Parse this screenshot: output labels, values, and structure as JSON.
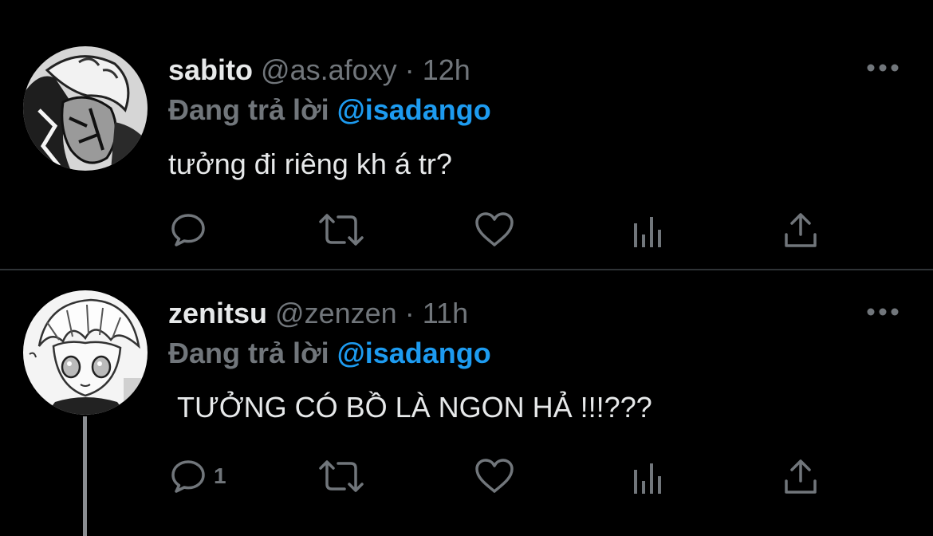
{
  "colors": {
    "background": "#000000",
    "text_primary": "#e7e9ea",
    "text_secondary": "#71767b",
    "mention_blue": "#1d9bf0",
    "divider": "#2f3336"
  },
  "tweets": [
    {
      "display_name": "sabito",
      "handle": "@as.afoxy",
      "separator": "·",
      "time": "12h",
      "reply_prefix": "Đang trả lời",
      "reply_to": "@isadango",
      "text": "tưởng đi riêng kh á tr?",
      "avatar_icon": "avatar-manga-sabito",
      "actions": [
        {
          "icon": "reply-icon",
          "count": ""
        },
        {
          "icon": "retweet-icon",
          "count": ""
        },
        {
          "icon": "like-icon",
          "count": ""
        },
        {
          "icon": "views-icon",
          "count": ""
        },
        {
          "icon": "share-icon",
          "count": ""
        }
      ]
    },
    {
      "display_name": "zenitsu",
      "handle": "@zenzen",
      "separator": "·",
      "time": "11h",
      "reply_prefix": "Đang trả lời",
      "reply_to": "@isadango",
      "text": "TƯỞNG CÓ BỒ LÀ NGON HẢ !!!???",
      "avatar_icon": "avatar-manga-zenitsu",
      "actions": [
        {
          "icon": "reply-icon",
          "count": "1"
        },
        {
          "icon": "retweet-icon",
          "count": ""
        },
        {
          "icon": "like-icon",
          "count": ""
        },
        {
          "icon": "views-icon",
          "count": ""
        },
        {
          "icon": "share-icon",
          "count": ""
        }
      ]
    }
  ]
}
